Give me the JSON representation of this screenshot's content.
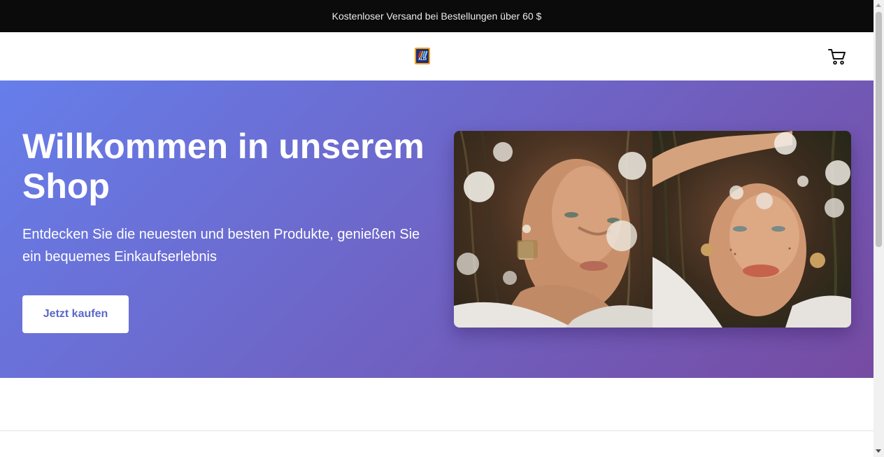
{
  "announcement": {
    "text": "Kostenloser Versand bei Bestellungen über 60 $"
  },
  "header": {
    "logo": {
      "name": "aldi-logo",
      "text": "ALDI"
    },
    "cart": {
      "icon": "cart-icon"
    }
  },
  "hero": {
    "title": "Willkommen in unserem Shop",
    "subtitle": "Entdecken Sie die neuesten und besten Produkte, genießen Sie ein bequemes Einkaufserlebnis",
    "button_label": "Jetzt kaufen",
    "gradient_start": "#667eea",
    "gradient_end": "#764ba2",
    "button_text_color": "#5b68c8"
  },
  "colors": {
    "announcement_bg": "#0b0b0b",
    "logo_orange": "#f6a319",
    "logo_blue": "#1b2f7c"
  }
}
